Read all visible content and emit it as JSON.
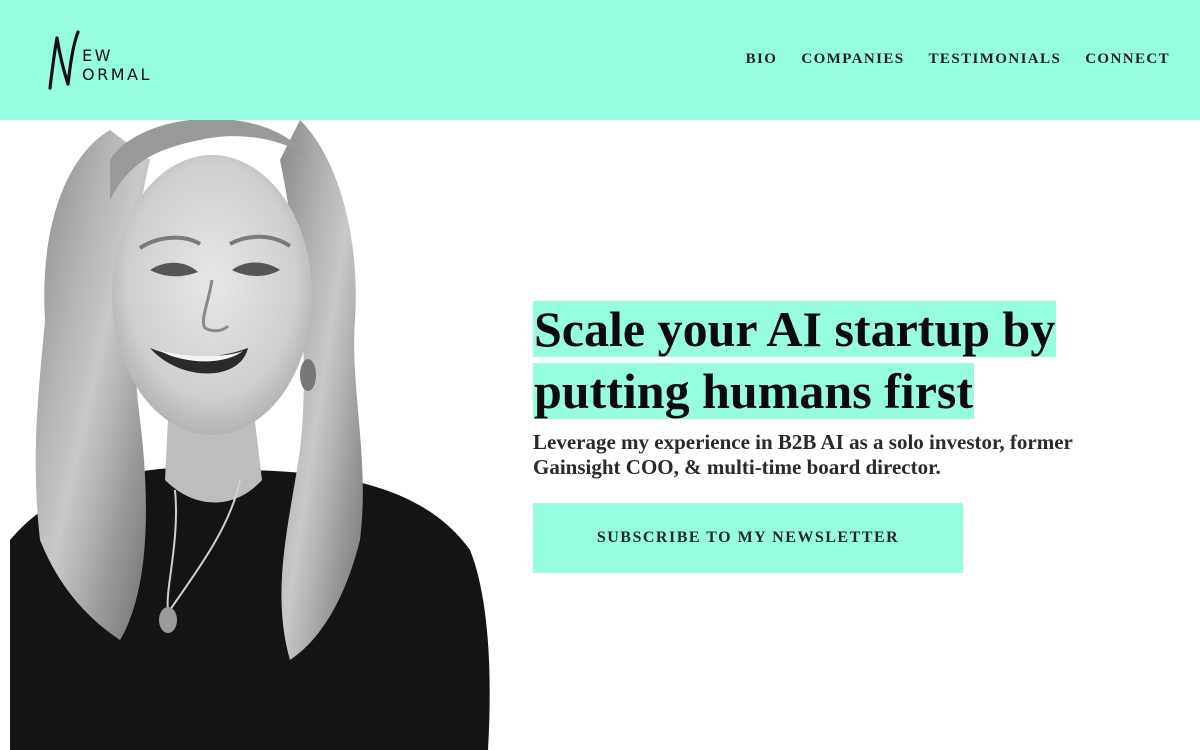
{
  "brand": {
    "logo_initial": "N",
    "logo_line1": "EW",
    "logo_line2": "ORMAL",
    "accent_color": "#97fde1"
  },
  "nav": {
    "items": [
      {
        "label": "BIO"
      },
      {
        "label": "COMPANIES"
      },
      {
        "label": "TESTIMONIALS"
      },
      {
        "label": "CONNECT"
      }
    ]
  },
  "hero": {
    "title_line1": "Scale your AI startup by",
    "title_line2": "putting humans first",
    "subtitle": "Leverage my experience in B2B AI as a solo investor, former Gainsight COO, & multi-time board director.",
    "cta_label": "SUBSCRIBE TO MY NEWSLETTER",
    "photo_style": "black-and-white"
  }
}
